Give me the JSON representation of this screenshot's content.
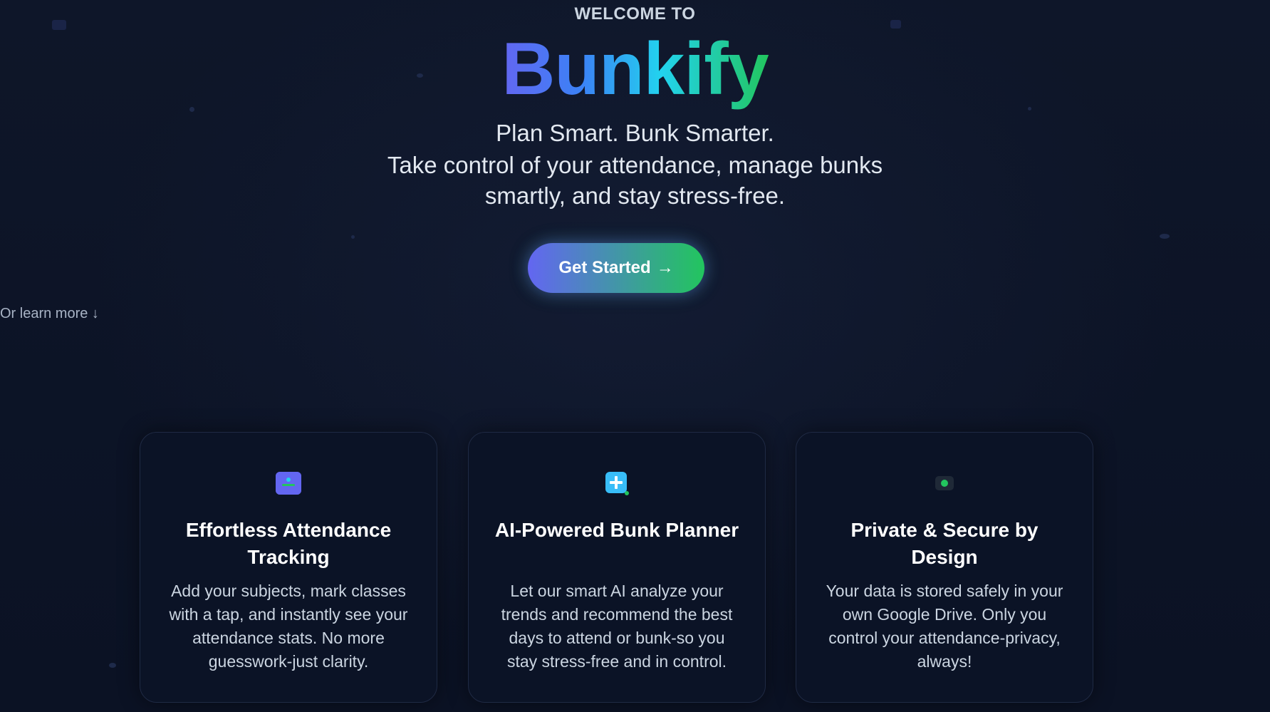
{
  "hero": {
    "eyebrow": "WELCOME TO",
    "brand": "Bunkify",
    "tagline_1": "Plan Smart. Bunk Smarter.",
    "tagline_2": "Take control of your attendance, manage bunks smartly, and stay stress-free.",
    "cta_label": "Get Started",
    "cta_arrow": "→",
    "learn_more": "Or learn more ↓"
  },
  "features": [
    {
      "icon": "user-card-icon",
      "title": "Effortless Attendance Tracking",
      "description": "Add your subjects, mark classes with a tap, and instantly see your attendance stats. No more guesswork-just clarity."
    },
    {
      "icon": "plus-sparkle-icon",
      "title": "AI-Powered Bunk Planner",
      "description": "Let our smart AI analyze your trends and recommend the best days to attend or bunk-so you stay stress-free and in control."
    },
    {
      "icon": "lock-dot-icon",
      "title": "Private & Secure by Design",
      "description": "Your data is stored safely in your own Google Drive. Only you control your attendance-privacy, always!"
    }
  ],
  "colors": {
    "background": "#0d1527",
    "gradient_start": "#6366f1",
    "gradient_end": "#22c55e"
  }
}
